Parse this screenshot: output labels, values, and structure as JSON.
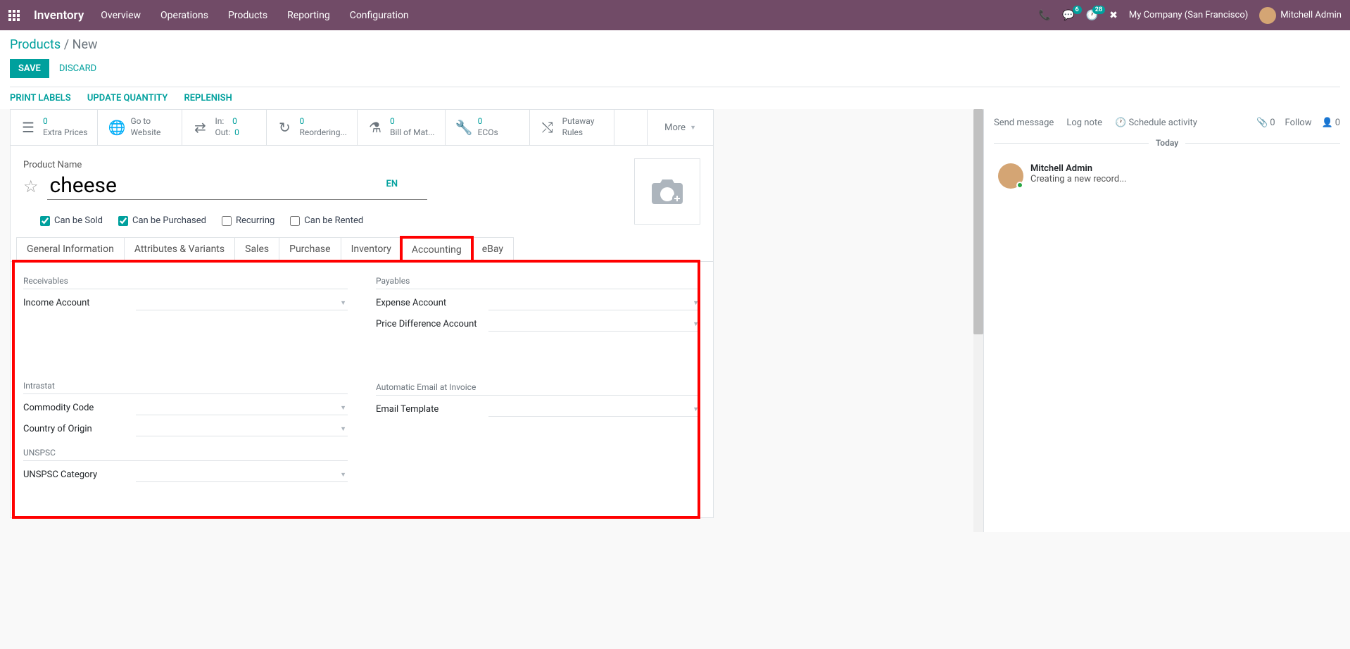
{
  "nav": {
    "brand": "Inventory",
    "menu": [
      "Overview",
      "Operations",
      "Products",
      "Reporting",
      "Configuration"
    ],
    "chat_badge": "6",
    "activity_badge": "28",
    "company": "My Company (San Francisco)",
    "user": "Mitchell Admin"
  },
  "breadcrumb": {
    "root": "Products",
    "current": "New"
  },
  "actions": {
    "save": "SAVE",
    "discard": "DISCARD"
  },
  "toolbar": {
    "print": "PRINT LABELS",
    "update_qty": "UPDATE QUANTITY",
    "replenish": "REPLENISH"
  },
  "stats": {
    "extra_prices": {
      "num": "0",
      "label": "Extra Prices"
    },
    "website": {
      "l1": "Go to",
      "l2": "Website"
    },
    "in": {
      "label": "In:",
      "num": "0"
    },
    "out": {
      "label": "Out:",
      "num": "0"
    },
    "reorder": {
      "num": "0",
      "label": "Reordering..."
    },
    "bom": {
      "num": "0",
      "label": "Bill of Mat..."
    },
    "ecos": {
      "num": "0",
      "label": "ECOs"
    },
    "putaway": {
      "l1": "Putaway",
      "l2": "Rules"
    },
    "more": "More"
  },
  "form": {
    "product_name_label": "Product Name",
    "product_name": "cheese",
    "lang": "EN",
    "checks": {
      "sold": "Can be Sold",
      "purchased": "Can be Purchased",
      "recurring": "Recurring",
      "rented": "Can be Rented"
    }
  },
  "tabs": [
    "General Information",
    "Attributes & Variants",
    "Sales",
    "Purchase",
    "Inventory",
    "Accounting",
    "eBay"
  ],
  "accounting": {
    "receivables": "Receivables",
    "income_account": "Income Account",
    "payables": "Payables",
    "expense_account": "Expense Account",
    "price_diff": "Price Difference Account",
    "intrastat": "Intrastat",
    "commodity": "Commodity Code",
    "country": "Country of Origin",
    "unspsc": "UNSPSC",
    "unspsc_cat": "UNSPSC Category",
    "auto_email": "Automatic Email at Invoice",
    "email_tmpl": "Email Template"
  },
  "chatter": {
    "send": "Send message",
    "log": "Log note",
    "schedule": "Schedule activity",
    "attach_count": "0",
    "follow": "Follow",
    "follower_count": "0",
    "today": "Today",
    "msg_author": "Mitchell Admin",
    "msg_body": "Creating a new record..."
  }
}
